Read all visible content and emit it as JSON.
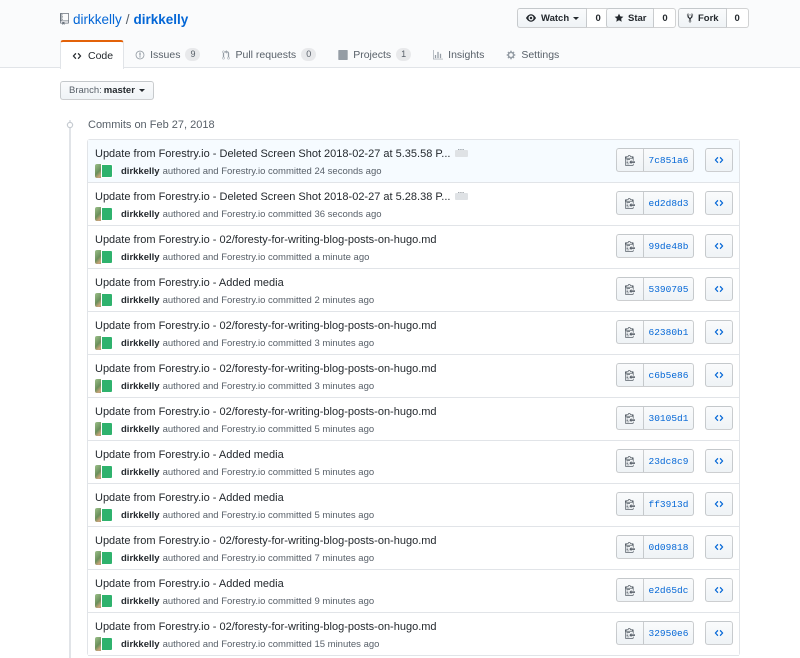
{
  "repo": {
    "owner": "dirkkelly",
    "separator": "/",
    "name": "dirkkelly"
  },
  "actions": {
    "watch": {
      "label": "Watch",
      "count": "0"
    },
    "star": {
      "label": "Star",
      "count": "0"
    },
    "fork": {
      "label": "Fork",
      "count": "0"
    }
  },
  "nav": {
    "code": "Code",
    "issues": "Issues",
    "issues_count": "9",
    "pulls": "Pull requests",
    "pulls_count": "0",
    "projects": "Projects",
    "projects_count": "1",
    "insights": "Insights",
    "settings": "Settings"
  },
  "branch": {
    "label": "Branch:",
    "value": "master"
  },
  "commit_group": {
    "title": "Commits on Feb 27, 2018"
  },
  "commits": [
    {
      "title": "Update from Forestry.io - Deleted Screen Shot 2018-02-27 at 5.35.58 P...",
      "author": "dirkkelly",
      "meta": "authored and Forestry.io committed 24 seconds ago",
      "sha": "7c851a6"
    },
    {
      "title": "Update from Forestry.io - Deleted Screen Shot 2018-02-27 at 5.28.38 P...",
      "author": "dirkkelly",
      "meta": "authored and Forestry.io committed 36 seconds ago",
      "sha": "ed2d8d3"
    },
    {
      "title": "Update from Forestry.io - 02/foresty-for-writing-blog-posts-on-hugo.md",
      "author": "dirkkelly",
      "meta": "authored and Forestry.io committed a minute ago",
      "sha": "99de48b"
    },
    {
      "title": "Update from Forestry.io - Added media",
      "author": "dirkkelly",
      "meta": "authored and Forestry.io committed 2 minutes ago",
      "sha": "5390705"
    },
    {
      "title": "Update from Forestry.io - 02/foresty-for-writing-blog-posts-on-hugo.md",
      "author": "dirkkelly",
      "meta": "authored and Forestry.io committed 3 minutes ago",
      "sha": "62380b1"
    },
    {
      "title": "Update from Forestry.io - 02/foresty-for-writing-blog-posts-on-hugo.md",
      "author": "dirkkelly",
      "meta": "authored and Forestry.io committed 3 minutes ago",
      "sha": "c6b5e86"
    },
    {
      "title": "Update from Forestry.io - 02/foresty-for-writing-blog-posts-on-hugo.md",
      "author": "dirkkelly",
      "meta": "authored and Forestry.io committed 5 minutes ago",
      "sha": "30105d1"
    },
    {
      "title": "Update from Forestry.io - Added media",
      "author": "dirkkelly",
      "meta": "authored and Forestry.io committed 5 minutes ago",
      "sha": "23dc8c9"
    },
    {
      "title": "Update from Forestry.io - Added media",
      "author": "dirkkelly",
      "meta": "authored and Forestry.io committed 5 minutes ago",
      "sha": "ff3913d"
    },
    {
      "title": "Update from Forestry.io - 02/foresty-for-writing-blog-posts-on-hugo.md",
      "author": "dirkkelly",
      "meta": "authored and Forestry.io committed 7 minutes ago",
      "sha": "0d09818"
    },
    {
      "title": "Update from Forestry.io - Added media",
      "author": "dirkkelly",
      "meta": "authored and Forestry.io committed 9 minutes ago",
      "sha": "e2d65dc"
    },
    {
      "title": "Update from Forestry.io - 02/foresty-for-writing-blog-posts-on-hugo.md",
      "author": "dirkkelly",
      "meta": "authored and Forestry.io committed 15 minutes ago",
      "sha": "32950e6"
    }
  ],
  "icons": {
    "repo": "repo-icon",
    "watch": "eye-icon",
    "star": "star-icon",
    "fork": "fork-icon",
    "code": "code-icon",
    "issues": "issue-icon",
    "pulls": "pull-request-icon",
    "projects": "project-icon",
    "insights": "graph-icon",
    "settings": "gear-icon",
    "copy": "clippy-icon",
    "browse": "code-icon"
  },
  "colors": {
    "link": "#0366d6",
    "active_tab": "#e36209",
    "header_bg": "#fafbfc"
  }
}
